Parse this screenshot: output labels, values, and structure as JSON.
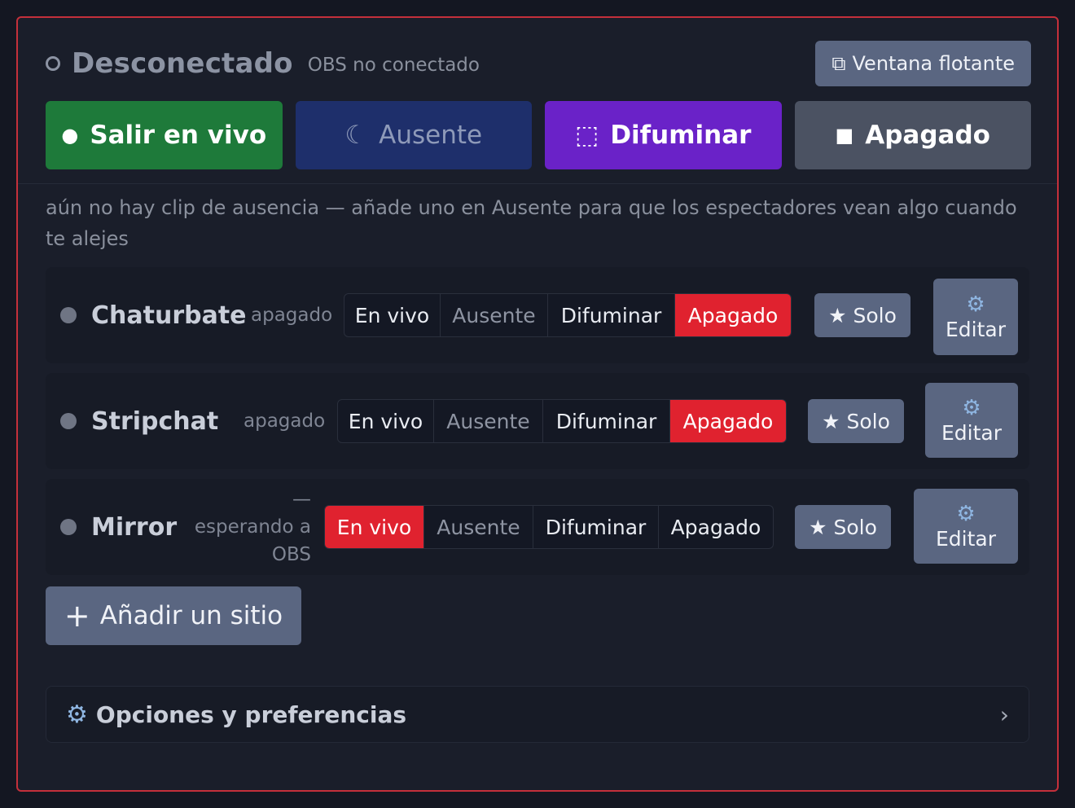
{
  "header": {
    "status_title": "Desconectado",
    "status_subtitle": "OBS no conectado",
    "float_button_icon": "⧉",
    "float_button_label": "Ventana flotante"
  },
  "modes": {
    "live_icon": "●",
    "live_label": "Salir en vivo",
    "away_icon": "☾",
    "away_label": "Ausente",
    "blur_icon": "⬚",
    "blur_label": "Difuminar",
    "off_icon": "■",
    "off_label": "Apagado"
  },
  "notice": "aún no hay clip de ausencia — añade uno en Ausente para que los espectadores vean algo cuando te alejes",
  "segment_labels": [
    "En vivo",
    "Ausente",
    "Difuminar",
    "Apagado"
  ],
  "sites": [
    {
      "name": "Chaturbate",
      "state": "apagado",
      "active": "Apagado",
      "solo_label": "★ Solo",
      "edit_label": "Editar",
      "edit_icon": "⚙"
    },
    {
      "name": "Stripchat",
      "state": "apagado",
      "active": "Apagado",
      "solo_label": "★ Solo",
      "edit_label": "Editar",
      "edit_icon": "⚙"
    },
    {
      "name": "Mirror",
      "state": "— esperando a OBS",
      "active": "En vivo",
      "solo_label": "★ Solo",
      "edit_label": "Editar",
      "edit_icon": "⚙"
    }
  ],
  "add_site_label": "Añadir un sitio",
  "add_site_icon": "+",
  "options": {
    "icon": "⚙",
    "label": "Opciones y preferencias",
    "chevron": "›"
  },
  "colors": {
    "border_accent": "#c4303b",
    "live": "#1e7a3a",
    "away": "#1e2f6b",
    "blur": "#6a22c8",
    "off": "#4b5262",
    "active_segment": "#e0222f",
    "button": "#5a6681"
  }
}
